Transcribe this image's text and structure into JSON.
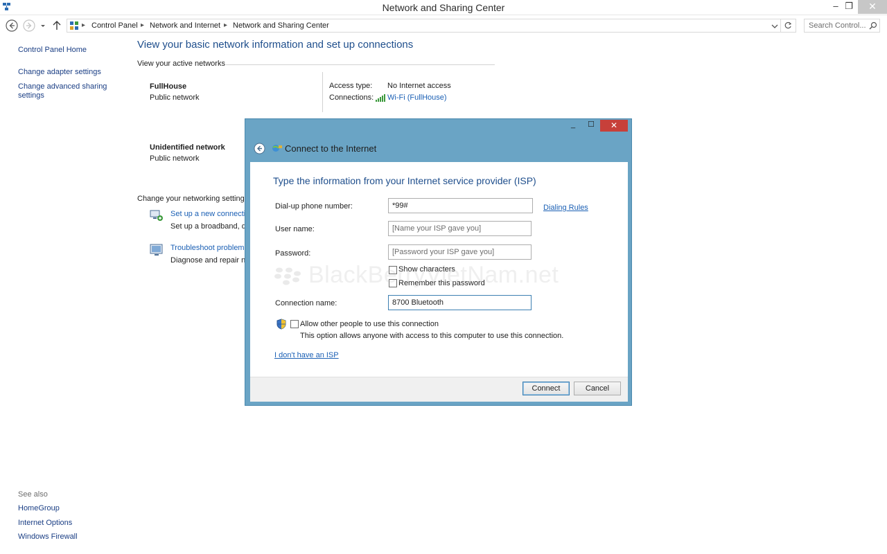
{
  "window": {
    "title": "Network and Sharing Center",
    "min": "–",
    "restore": "❐",
    "close": "✕"
  },
  "address": {
    "crumbs": [
      "Control Panel",
      "Network and Internet",
      "Network and Sharing Center"
    ],
    "search_placeholder": "Search Control..."
  },
  "sidebar": {
    "home": "Control Panel Home",
    "adapter": "Change adapter settings",
    "advanced": "Change advanced sharing settings",
    "see_also": "See also",
    "links": [
      "HomeGroup",
      "Internet Options",
      "Windows Firewall"
    ]
  },
  "main": {
    "title": "View your basic network information and set up connections",
    "active_header": "View your active networks",
    "networks": [
      {
        "name": "FullHouse",
        "type": "Public network"
      },
      {
        "name": "Unidentified network",
        "type": "Public network"
      }
    ],
    "access_type_label": "Access type:",
    "access_type_value": "No Internet access",
    "connections_label": "Connections:",
    "connections_value": "Wi-Fi (FullHouse)",
    "change_header": "Change your networking settings",
    "setup_link": "Set up a new connectio",
    "setup_desc": "Set up a broadband, di",
    "troubleshoot_link": "Troubleshoot problems",
    "troubleshoot_desc": "Diagnose and repair ne"
  },
  "dialog": {
    "title": "Connect to the Internet",
    "heading": "Type the information from your Internet service provider (ISP)",
    "dialup_label": "Dial-up phone number:",
    "dialup_value": "*99#",
    "dialing_rules": "Dialing Rules",
    "username_label": "User name:",
    "username_placeholder": "[Name your ISP gave you]",
    "password_label": "Password:",
    "password_placeholder": "[Password your ISP gave you]",
    "show_chars": "Show characters",
    "remember_pw": "Remember this password",
    "connname_label": "Connection name:",
    "connname_value": "8700 Bluetooth",
    "allow_others": "Allow other people to use this connection",
    "allow_desc": "This option allows anyone with access to this computer to use this connection.",
    "no_isp": "I don't have an ISP",
    "connect": "Connect",
    "cancel": "Cancel",
    "min": "_",
    "max": "☐",
    "close": "✕"
  },
  "watermark": "BlackBerryVietNam.net",
  "colors": {
    "accent_title": "#1e4e8c",
    "link": "#1a3e84",
    "dialog_frame": "#6aa4c5",
    "close_red": "#c7403a"
  }
}
